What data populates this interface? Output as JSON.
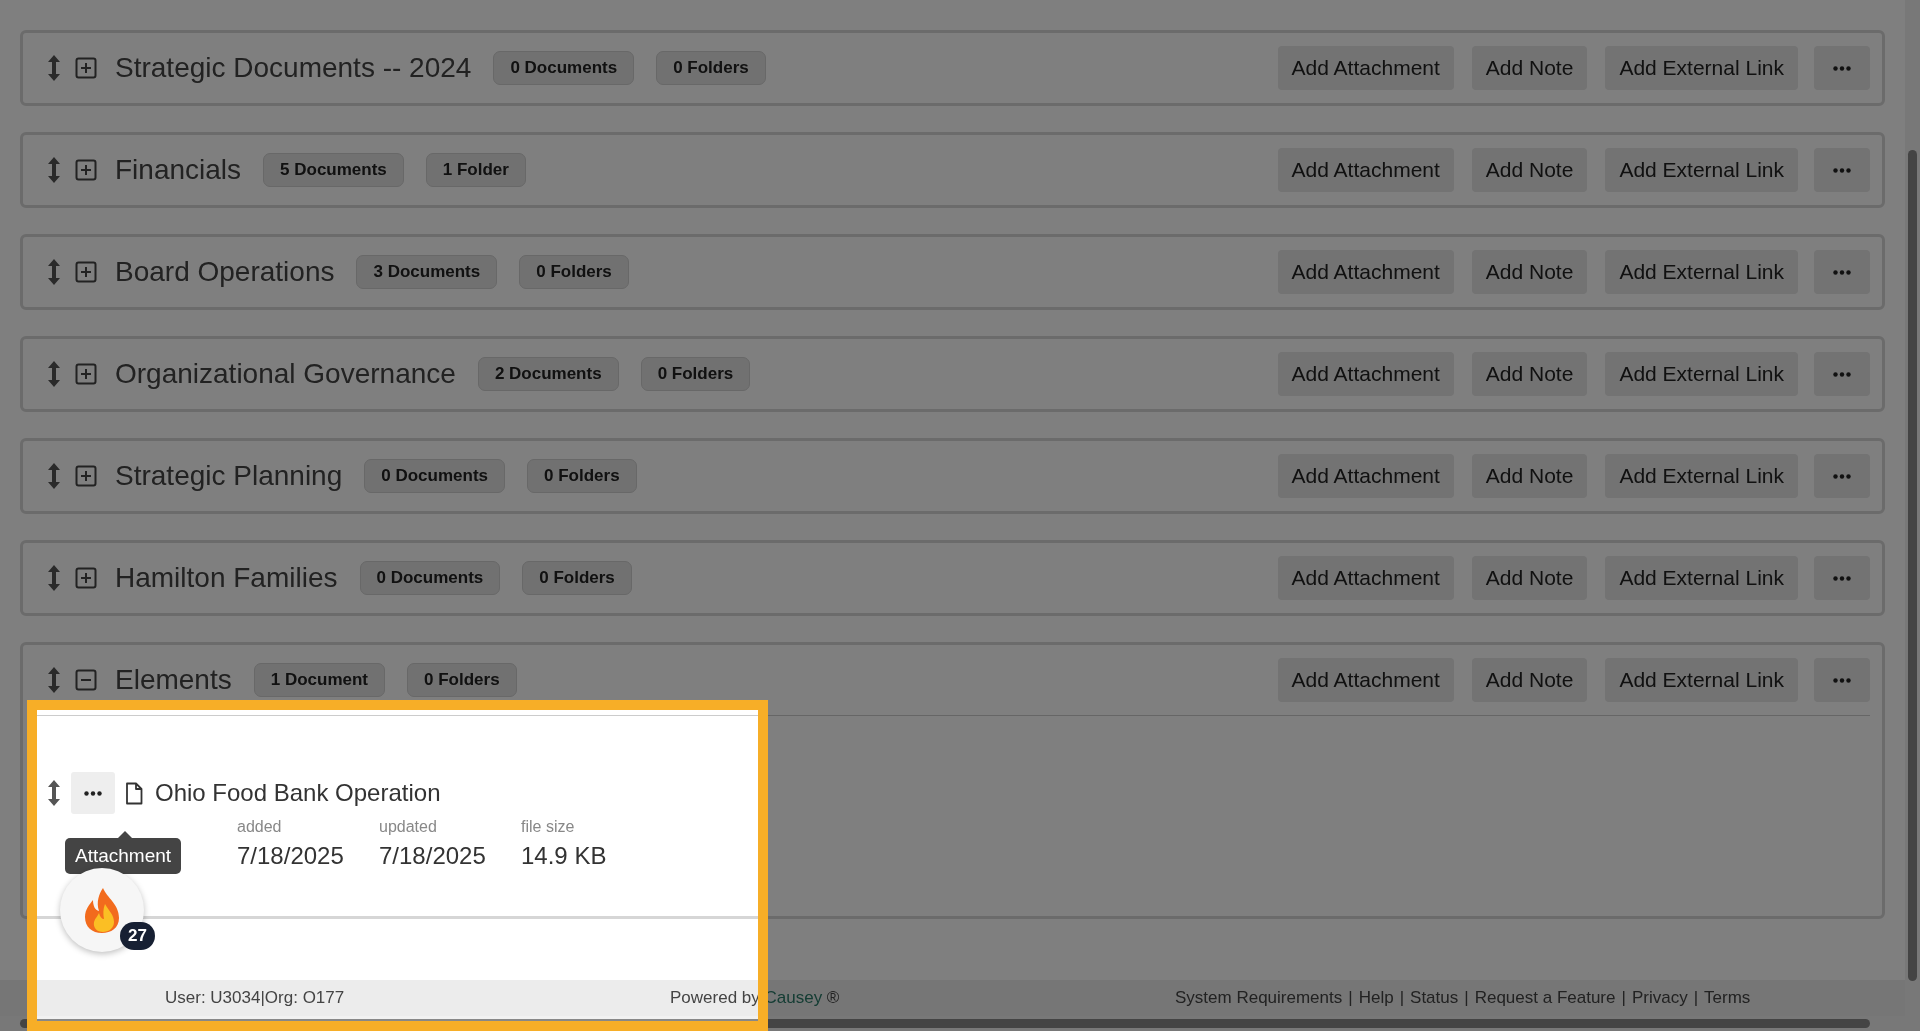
{
  "folders": [
    {
      "title": "Strategic Documents -- 2024",
      "documents": "0 Documents",
      "subfolders": "0 Folders",
      "expanded": false,
      "actions": [
        "Add Attachment",
        "Add Note",
        "Add External Link"
      ]
    },
    {
      "title": "Financials",
      "documents": "5 Documents",
      "subfolders": "1 Folder",
      "expanded": false,
      "actions": [
        "Add Attachment",
        "Add Note",
        "Add External Link"
      ]
    },
    {
      "title": "Board Operations",
      "documents": "3 Documents",
      "subfolders": "0 Folders",
      "expanded": false,
      "actions": [
        "Add Attachment",
        "Add Note",
        "Add External Link"
      ]
    },
    {
      "title": "Organizational Governance",
      "documents": "2 Documents",
      "subfolders": "0 Folders",
      "expanded": false,
      "actions": [
        "Add Attachment",
        "Add Note",
        "Add External Link"
      ]
    },
    {
      "title": "Strategic Planning",
      "documents": "0 Documents",
      "subfolders": "0 Folders",
      "expanded": false,
      "actions": [
        "Add Attachment",
        "Add Note",
        "Add External Link"
      ]
    },
    {
      "title": "Hamilton Families",
      "documents": "0 Documents",
      "subfolders": "0 Folders",
      "expanded": false,
      "actions": [
        "Add Attachment",
        "Add Note",
        "Add External Link"
      ]
    },
    {
      "title": "Elements",
      "documents": "1 Document",
      "subfolders": "0 Folders",
      "expanded": true,
      "actions": [
        "Add Attachment",
        "Add Note",
        "Add External Link"
      ],
      "items": [
        {
          "kind": "attachment",
          "name": "Ohio Food Bank Operation",
          "meta": [
            {
              "label": "added",
              "value": "7/18/2025"
            },
            {
              "label": "updated",
              "value": "7/18/2025"
            },
            {
              "label": "file size",
              "value": "14.9 KB"
            }
          ]
        }
      ]
    }
  ],
  "tooltip": {
    "text": "Attachment"
  },
  "notification_badge": {
    "count": "27"
  },
  "footer": {
    "user": "User: U3034|Org: O177",
    "powered_by": "Powered by",
    "brand": "Causey",
    "brand_mark": "®",
    "separator": "|",
    "links": [
      "System Requirements",
      "Help",
      "Status",
      "Request a Feature",
      "Privacy",
      "Terms"
    ]
  }
}
